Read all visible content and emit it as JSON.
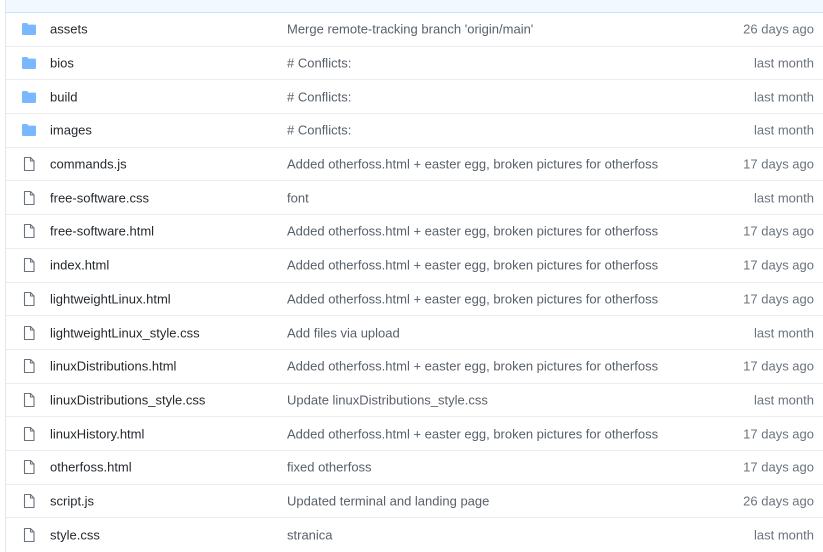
{
  "colors": {
    "folder_icon": "#79b8ff",
    "file_icon": "#6a737d",
    "header_bg": "#f1f8ff",
    "row_border": "#eaecef"
  },
  "files": [
    {
      "type": "folder",
      "icon": "folder-icon",
      "name": "assets",
      "message": "Merge remote-tracking branch 'origin/main'",
      "age": "26 days ago"
    },
    {
      "type": "folder",
      "icon": "folder-icon",
      "name": "bios",
      "message": "# Conflicts:",
      "age": "last month"
    },
    {
      "type": "folder",
      "icon": "folder-icon",
      "name": "build",
      "message": "# Conflicts:",
      "age": "last month"
    },
    {
      "type": "folder",
      "icon": "folder-icon",
      "name": "images",
      "message": "# Conflicts:",
      "age": "last month"
    },
    {
      "type": "file",
      "icon": "file-icon",
      "name": "commands.js",
      "message": "Added otherfoss.html + easter egg, broken pictures for otherfoss",
      "age": "17 days ago"
    },
    {
      "type": "file",
      "icon": "file-icon",
      "name": "free-software.css",
      "message": "font",
      "age": "last month"
    },
    {
      "type": "file",
      "icon": "file-icon",
      "name": "free-software.html",
      "message": "Added otherfoss.html + easter egg, broken pictures for otherfoss",
      "age": "17 days ago"
    },
    {
      "type": "file",
      "icon": "file-icon",
      "name": "index.html",
      "message": "Added otherfoss.html + easter egg, broken pictures for otherfoss",
      "age": "17 days ago"
    },
    {
      "type": "file",
      "icon": "file-icon",
      "name": "lightweightLinux.html",
      "message": "Added otherfoss.html + easter egg, broken pictures for otherfoss",
      "age": "17 days ago"
    },
    {
      "type": "file",
      "icon": "file-icon",
      "name": "lightweightLinux_style.css",
      "message": "Add files via upload",
      "age": "last month"
    },
    {
      "type": "file",
      "icon": "file-icon",
      "name": "linuxDistributions.html",
      "message": "Added otherfoss.html + easter egg, broken pictures for otherfoss",
      "age": "17 days ago"
    },
    {
      "type": "file",
      "icon": "file-icon",
      "name": "linuxDistributions_style.css",
      "message": "Update linuxDistributions_style.css",
      "age": "last month"
    },
    {
      "type": "file",
      "icon": "file-icon",
      "name": "linuxHistory.html",
      "message": "Added otherfoss.html + easter egg, broken pictures for otherfoss",
      "age": "17 days ago"
    },
    {
      "type": "file",
      "icon": "file-icon",
      "name": "otherfoss.html",
      "message": "fixed otherfoss",
      "age": "17 days ago"
    },
    {
      "type": "file",
      "icon": "file-icon",
      "name": "script.js",
      "message": "Updated terminal and landing page",
      "age": "26 days ago"
    },
    {
      "type": "file",
      "icon": "file-icon",
      "name": "style.css",
      "message": "stranica",
      "age": "last month"
    }
  ]
}
